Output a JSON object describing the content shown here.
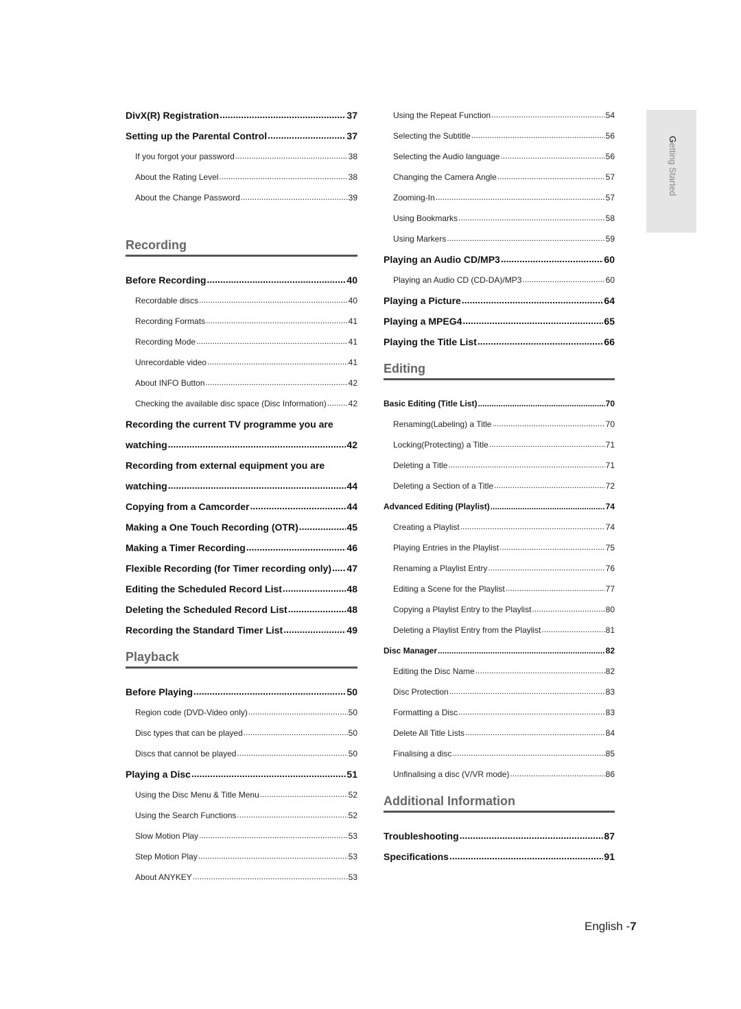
{
  "side_tab": {
    "first_letter": "G",
    "rest": "etting Started"
  },
  "footer": {
    "language": "English -",
    "page_number": "7"
  },
  "left_column": [
    {
      "type": "entry",
      "level": 1,
      "title": "DivX(R) Registration",
      "page": "37"
    },
    {
      "type": "entry",
      "level": 1,
      "title": "Setting up the Parental Control",
      "page": "37"
    },
    {
      "type": "entry",
      "level": 2,
      "title": "If you forgot your password",
      "page": "38"
    },
    {
      "type": "entry",
      "level": 2,
      "title": "About the Rating Level",
      "page": "38"
    },
    {
      "type": "entry",
      "level": 2,
      "title": "About the Change Password",
      "page": "39"
    },
    {
      "type": "gap"
    },
    {
      "type": "section",
      "title": "Recording"
    },
    {
      "type": "entry",
      "level": 1,
      "title": "Before Recording",
      "page": "40"
    },
    {
      "type": "entry",
      "level": 2,
      "title": "Recordable discs",
      "page": "40"
    },
    {
      "type": "entry",
      "level": 2,
      "title": "Recording Formats",
      "page": "41"
    },
    {
      "type": "entry",
      "level": 2,
      "title": "Recording Mode",
      "page": "41"
    },
    {
      "type": "entry",
      "level": 2,
      "title": "Unrecordable video",
      "page": "41"
    },
    {
      "type": "entry",
      "level": 2,
      "title": "About INFO Button",
      "page": "42"
    },
    {
      "type": "entry",
      "level": 2,
      "title": "Checking the available disc space (Disc Information)",
      "page": "42"
    },
    {
      "type": "text",
      "level": 1,
      "title": "Recording the current TV programme you are"
    },
    {
      "type": "entry",
      "level": 1,
      "title": "watching",
      "page": "42"
    },
    {
      "type": "text",
      "level": 1,
      "title": "Recording from external equipment you are"
    },
    {
      "type": "entry",
      "level": 1,
      "title": "watching",
      "page": "44"
    },
    {
      "type": "entry",
      "level": 1,
      "title": "Copying from a Camcorder",
      "page": "44"
    },
    {
      "type": "entry",
      "level": 1,
      "title": "Making a One Touch Recording (OTR)",
      "page": "45"
    },
    {
      "type": "entry",
      "level": 1,
      "title": "Making a Timer Recording",
      "page": "46"
    },
    {
      "type": "entry",
      "level": 1,
      "title": "Flexible Recording (for Timer recording only)",
      "page": "47"
    },
    {
      "type": "entry",
      "level": 1,
      "title": "Editing the Scheduled Record List",
      "page": "48"
    },
    {
      "type": "entry",
      "level": 1,
      "title": "Deleting the Scheduled Record List",
      "page": "48"
    },
    {
      "type": "entry",
      "level": 1,
      "title": "Recording the Standard Timer List",
      "page": "49"
    },
    {
      "type": "section",
      "title": "Playback"
    },
    {
      "type": "entry",
      "level": 1,
      "title": "Before Playing",
      "page": "50"
    },
    {
      "type": "entry",
      "level": 2,
      "title": "Region code (DVD-Video only)",
      "page": "50"
    },
    {
      "type": "entry",
      "level": 2,
      "title": "Disc types that can be played",
      "page": "50"
    },
    {
      "type": "entry",
      "level": 2,
      "title": "Discs that cannot be played",
      "page": "50"
    },
    {
      "type": "entry",
      "level": 1,
      "title": "Playing a Disc",
      "page": "51"
    },
    {
      "type": "entry",
      "level": 2,
      "title": "Using the Disc Menu & Title Menu",
      "page": "52"
    },
    {
      "type": "entry",
      "level": 2,
      "title": "Using the Search Functions",
      "page": "52"
    },
    {
      "type": "entry",
      "level": 2,
      "title": "Slow Motion Play",
      "page": "53"
    },
    {
      "type": "entry",
      "level": 2,
      "title": "Step Motion Play",
      "page": "53"
    },
    {
      "type": "entry",
      "level": 2,
      "title": "About ANYKEY",
      "page": "53"
    }
  ],
  "right_column": [
    {
      "type": "entry",
      "level": 2,
      "title": "Using the Repeat Function",
      "page": "54"
    },
    {
      "type": "entry",
      "level": 2,
      "title": "Selecting the Subtitle",
      "page": "56"
    },
    {
      "type": "entry",
      "level": 2,
      "title": "Selecting the Audio language",
      "page": "56"
    },
    {
      "type": "entry",
      "level": 2,
      "title": "Changing the Camera Angle",
      "page": "57"
    },
    {
      "type": "entry",
      "level": 2,
      "title": "Zooming-In",
      "page": "57"
    },
    {
      "type": "entry",
      "level": 2,
      "title": "Using Bookmarks",
      "page": "58"
    },
    {
      "type": "entry",
      "level": 2,
      "title": "Using Markers",
      "page": "59"
    },
    {
      "type": "entry",
      "level": 1,
      "title": "Playing an Audio CD/MP3",
      "page": "60"
    },
    {
      "type": "entry",
      "level": 2,
      "title": "Playing an Audio CD (CD-DA)/MP3",
      "page": "60"
    },
    {
      "type": "entry",
      "level": 1,
      "title": "Playing a Picture",
      "page": "64"
    },
    {
      "type": "entry",
      "level": 1,
      "title": "Playing a MPEG4",
      "page": "65"
    },
    {
      "type": "entry",
      "level": 1,
      "title": "Playing the Title List",
      "page": "66"
    },
    {
      "type": "section",
      "title": "Editing"
    },
    {
      "type": "entry",
      "level": 3,
      "title": "Basic Editing (Title List)",
      "page": "70"
    },
    {
      "type": "entry",
      "level": 2,
      "title": "Renaming(Labeling) a Title",
      "page": "70"
    },
    {
      "type": "entry",
      "level": 2,
      "title": "Locking(Protecting) a Title",
      "page": "71"
    },
    {
      "type": "entry",
      "level": 2,
      "title": "Deleting a Title",
      "page": "71"
    },
    {
      "type": "entry",
      "level": 2,
      "title": "Deleting a Section of a Title",
      "page": "72"
    },
    {
      "type": "entry",
      "level": 3,
      "title": "Advanced Editing (Playlist)",
      "page": "74"
    },
    {
      "type": "entry",
      "level": 2,
      "title": "Creating a Playlist",
      "page": "74"
    },
    {
      "type": "entry",
      "level": 2,
      "title": "Playing Entries in the Playlist",
      "page": "75"
    },
    {
      "type": "entry",
      "level": 2,
      "title": "Renaming a Playlist Entry",
      "page": "76"
    },
    {
      "type": "entry",
      "level": 2,
      "title": "Editing a Scene for the Playlist",
      "page": "77"
    },
    {
      "type": "entry",
      "level": 2,
      "title": "Copying a Playlist Entry to the Playlist",
      "page": "80"
    },
    {
      "type": "entry",
      "level": 2,
      "title": "Deleting a Playlist Entry from the Playlist",
      "page": "81"
    },
    {
      "type": "entry",
      "level": 3,
      "title": "Disc Manager",
      "page": "82"
    },
    {
      "type": "entry",
      "level": 2,
      "title": "Editing the Disc Name",
      "page": "82"
    },
    {
      "type": "entry",
      "level": 2,
      "title": "Disc Protection",
      "page": "83"
    },
    {
      "type": "entry",
      "level": 2,
      "title": "Formatting a Disc",
      "page": "83"
    },
    {
      "type": "entry",
      "level": 2,
      "title": "Delete All Title Lists",
      "page": "84"
    },
    {
      "type": "entry",
      "level": 2,
      "title": "Finalising a disc",
      "page": "85"
    },
    {
      "type": "entry",
      "level": 2,
      "title": "Unfinalising a disc (V/VR mode)",
      "page": "86"
    },
    {
      "type": "section",
      "title": "Additional Information"
    },
    {
      "type": "entry",
      "level": 1,
      "title": "Troubleshooting",
      "page": "87"
    },
    {
      "type": "entry",
      "level": 1,
      "title": "Specifications",
      "page": "91"
    }
  ]
}
